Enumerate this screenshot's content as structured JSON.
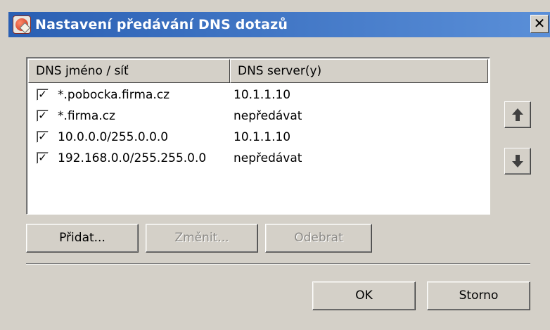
{
  "window": {
    "title": "Nastavení předávání DNS dotazů",
    "close_label": "✕"
  },
  "list": {
    "columns": [
      "DNS jméno / síť",
      "DNS server(y)"
    ],
    "rows": [
      {
        "checked": true,
        "name": "*.pobocka.firma.cz",
        "server": "10.1.1.10"
      },
      {
        "checked": true,
        "name": "*.firma.cz",
        "server": "nepředávat"
      },
      {
        "checked": true,
        "name": "10.0.0.0/255.0.0.0",
        "server": "10.1.1.10"
      },
      {
        "checked": true,
        "name": "192.168.0.0/255.255.0.0",
        "server": "nepředávat"
      }
    ],
    "check_mark": "✓"
  },
  "side_buttons": {
    "up_glyph": "🡅",
    "down_glyph": "🡇"
  },
  "buttons": {
    "add": "Přidat...",
    "edit": "Změnit...",
    "remove": "Odebrat",
    "ok": "OK",
    "cancel": "Storno"
  },
  "colors": {
    "title_bar_start": "#2a5fb3",
    "title_bar_end": "#5a8fd8",
    "face": "#d4d0c8"
  }
}
